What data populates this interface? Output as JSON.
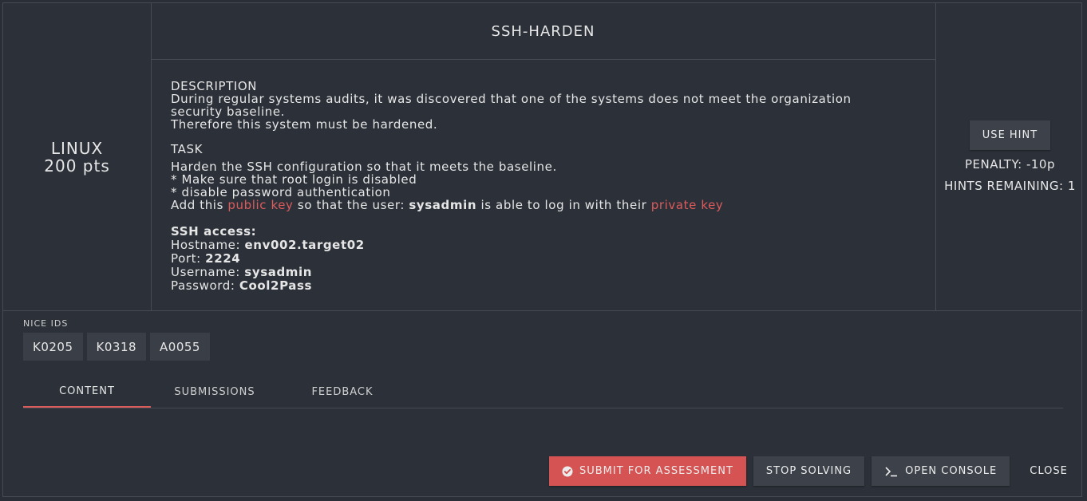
{
  "challenge": {
    "category": "LINUX",
    "points": "200 pts",
    "title": "SSH-HARDEN"
  },
  "description": {
    "label": "DESCRIPTION",
    "line1": "During regular systems audits, it was discovered that one of the systems does not meet the organization",
    "line2": "security baseline.",
    "line3": "Therefore this system must be hardened."
  },
  "task": {
    "label": "TASK",
    "line1": "Harden the SSH configuration so that it meets the baseline.",
    "line2": "* Make sure that root login is disabled",
    "line3": "* disable password authentication",
    "add_prefix": "Add this ",
    "public_key_link": "public key",
    "add_middle": " so that the user: ",
    "user": "sysadmin",
    "add_suffix": " is able to log in with their ",
    "private_key_link": "private key"
  },
  "ssh": {
    "header": "SSH access:",
    "hostname_label": "Hostname: ",
    "hostname": "env002.target02",
    "port_label": "Port: ",
    "port": "2224",
    "username_label": "Username: ",
    "username": "sysadmin",
    "password_label": "Password: ",
    "password": "Cool2Pass"
  },
  "hint": {
    "button": "USE HINT",
    "penalty": "PENALTY: -10p",
    "remaining": "HINTS REMAINING: 1"
  },
  "nice_ids": {
    "label": "NICE IDS",
    "items": [
      "K0205",
      "K0318",
      "A0055"
    ]
  },
  "tabs": [
    {
      "label": "CONTENT",
      "active": true
    },
    {
      "label": "SUBMISSIONS",
      "active": false
    },
    {
      "label": "FEEDBACK",
      "active": false
    }
  ],
  "actions": {
    "submit": "SUBMIT FOR ASSESSMENT",
    "stop": "STOP SOLVING",
    "console": "OPEN CONSOLE",
    "close": "CLOSE"
  },
  "colors": {
    "accent": "#dc5b5b",
    "background": "#2c3139"
  },
  "icons": {
    "submit": "check-circle-icon",
    "console": "terminal-prompt-icon"
  }
}
